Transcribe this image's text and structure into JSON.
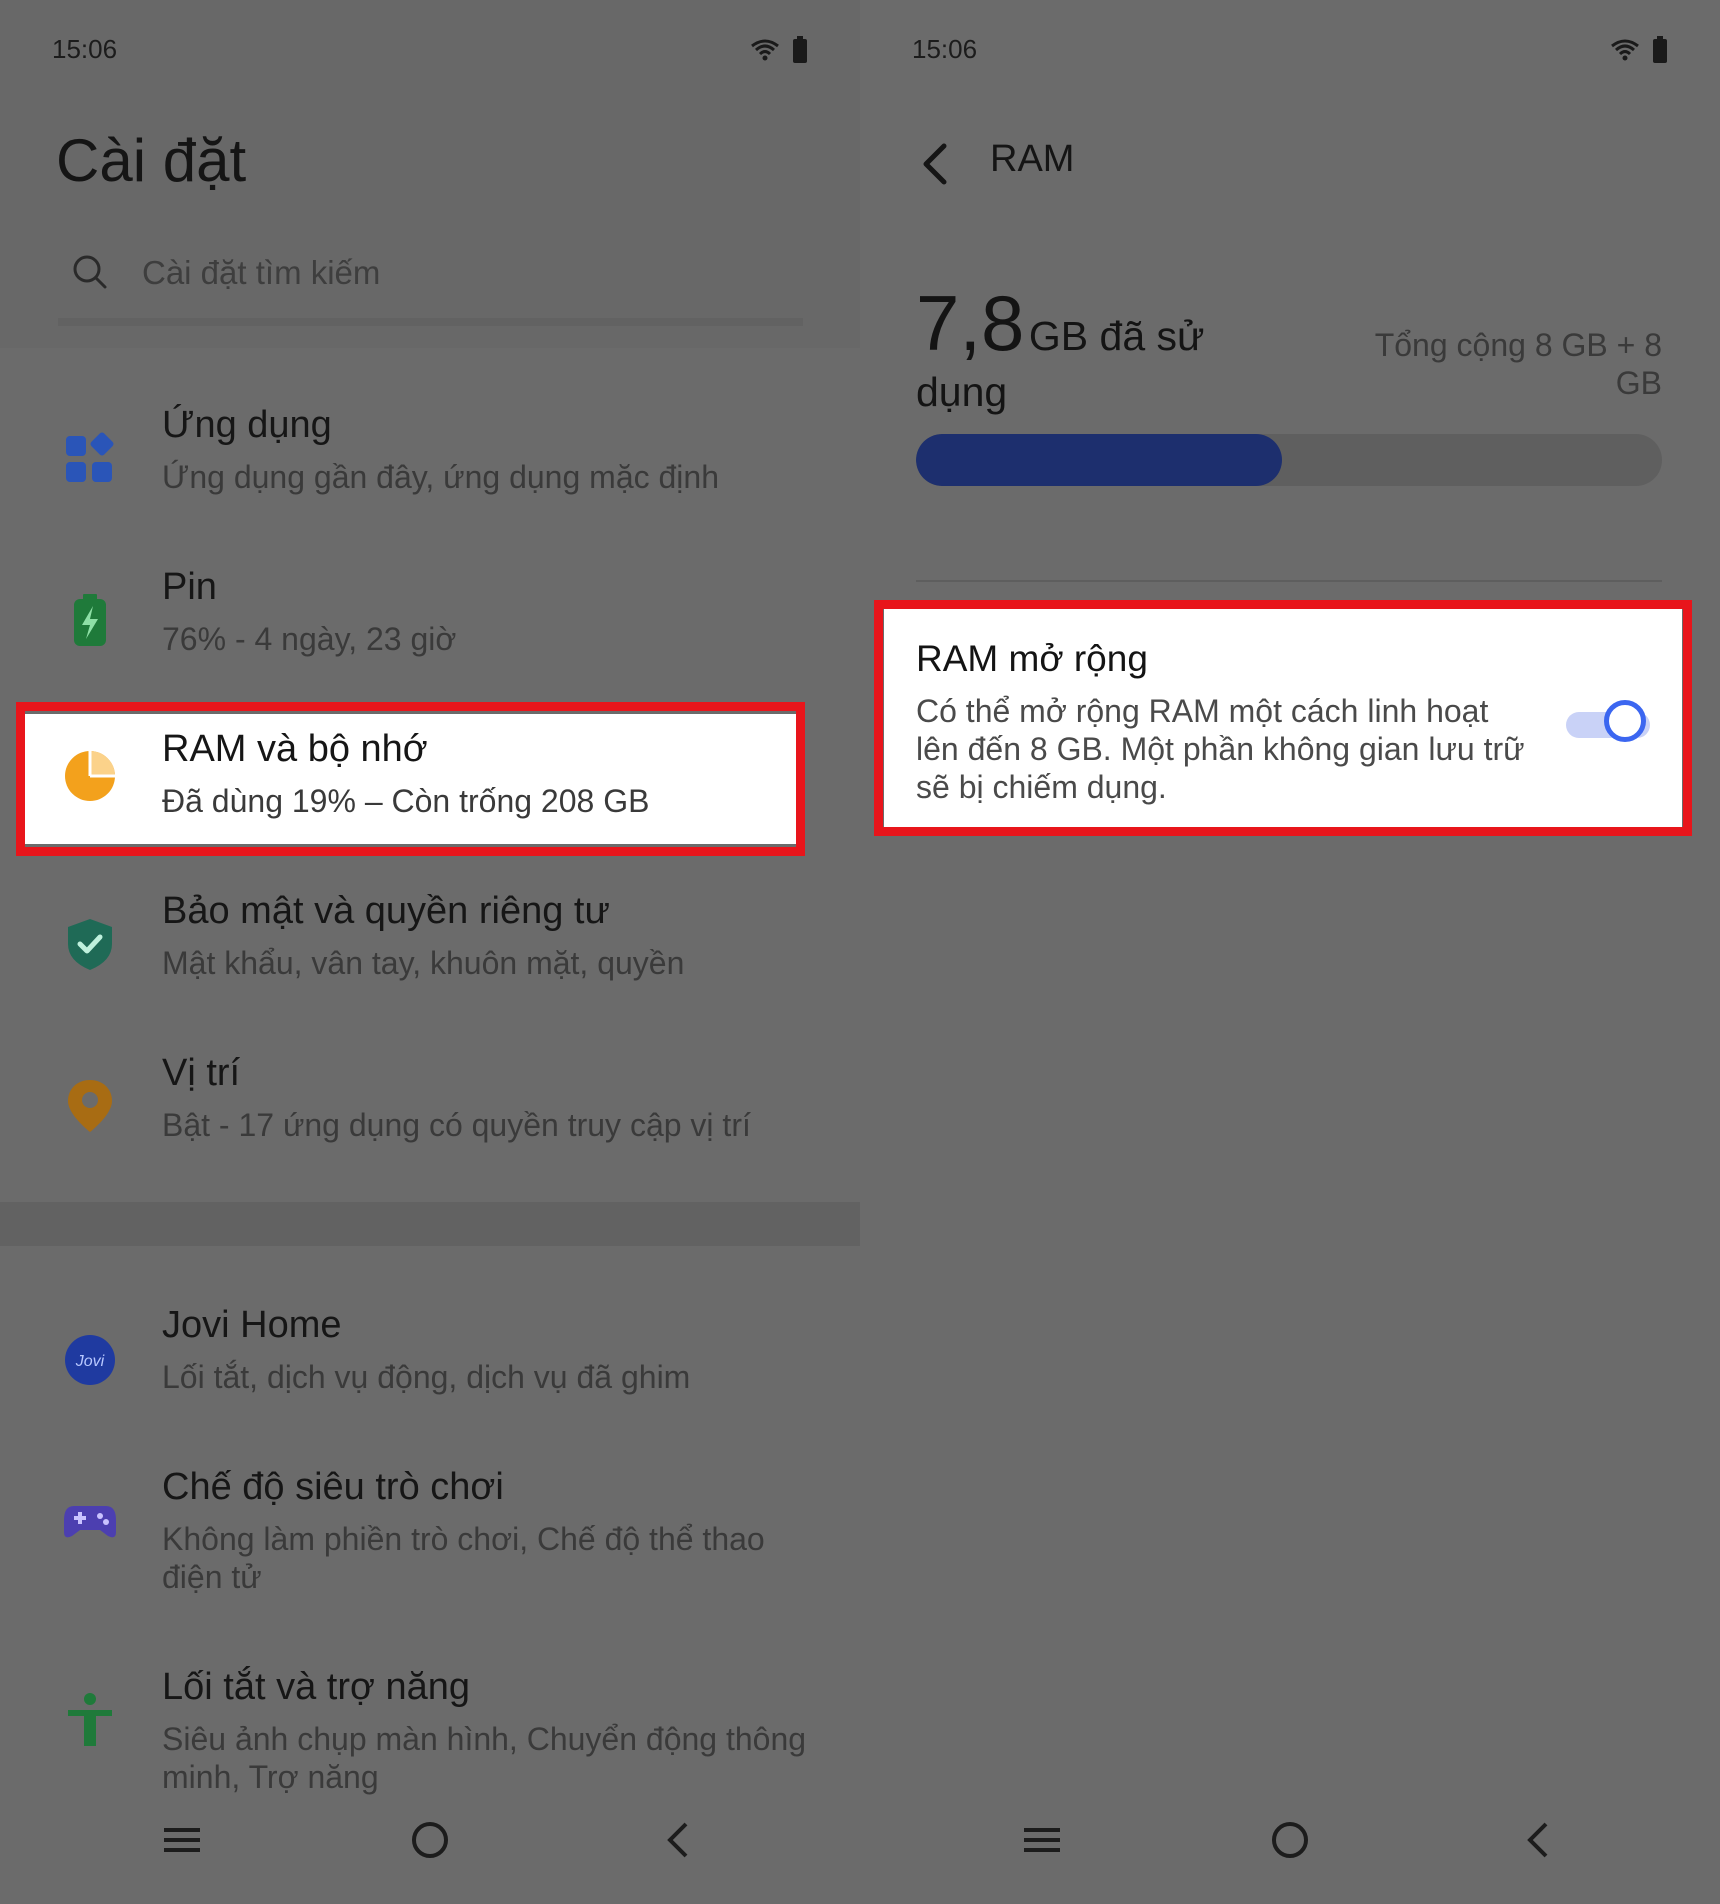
{
  "left": {
    "status": {
      "time": "15:06"
    },
    "title": "Cài đặt",
    "search_placeholder": "Cài đặt tìm kiếm",
    "items": [
      {
        "title": "Ứng dụng",
        "subtitle": "Ứng dụng gần đây, ứng dụng mặc định",
        "icon": "apps-grid-icon"
      },
      {
        "title": "Pin",
        "subtitle": "76% - 4 ngày, 23 giờ",
        "icon": "battery-icon"
      },
      {
        "title": "RAM và bộ nhớ",
        "subtitle": "Đã dùng 19% – Còn trống 208 GB",
        "icon": "pie-chart-icon"
      },
      {
        "title": "Bảo mật và quyền riêng tư",
        "subtitle": "Mật khẩu, vân tay, khuôn mặt, quyền",
        "icon": "shield-check-icon"
      },
      {
        "title": "Vị trí",
        "subtitle": "Bật - 17 ứng dụng có quyền truy cập vị trí",
        "icon": "location-pin-icon"
      },
      {
        "title": "Jovi Home",
        "subtitle": "Lối tắt, dịch vụ động, dịch vụ đã ghim",
        "icon": "jovi-icon",
        "icon_text": "Jovi"
      },
      {
        "title": "Chế độ siêu trò chơi",
        "subtitle": "Không làm phiền trò chơi, Chế độ thể thao điện tử",
        "icon": "gamepad-icon"
      },
      {
        "title": "Lối tắt và trợ năng",
        "subtitle": "Siêu ảnh chụp màn hình, Chuyển động thông minh, Trợ năng",
        "icon": "accessibility-icon"
      }
    ]
  },
  "right": {
    "status": {
      "time": "15:06"
    },
    "title": "RAM",
    "used_value": "7,8",
    "used_suffix": "GB đã sử dụng",
    "total": "Tổng cộng 8 GB + 8 GB",
    "usage_fraction": 0.49,
    "extended": {
      "title": "RAM mở rộng",
      "description": "Có thể mở rộng RAM một cách linh hoạt lên đến 8 GB. Một phần không gian lưu trữ sẽ bị chiếm dụng.",
      "enabled": true
    }
  },
  "colors": {
    "highlight_border": "#e8151b",
    "progress_fill": "#1d2f6e",
    "toggle_accent": "#3b66f0"
  }
}
